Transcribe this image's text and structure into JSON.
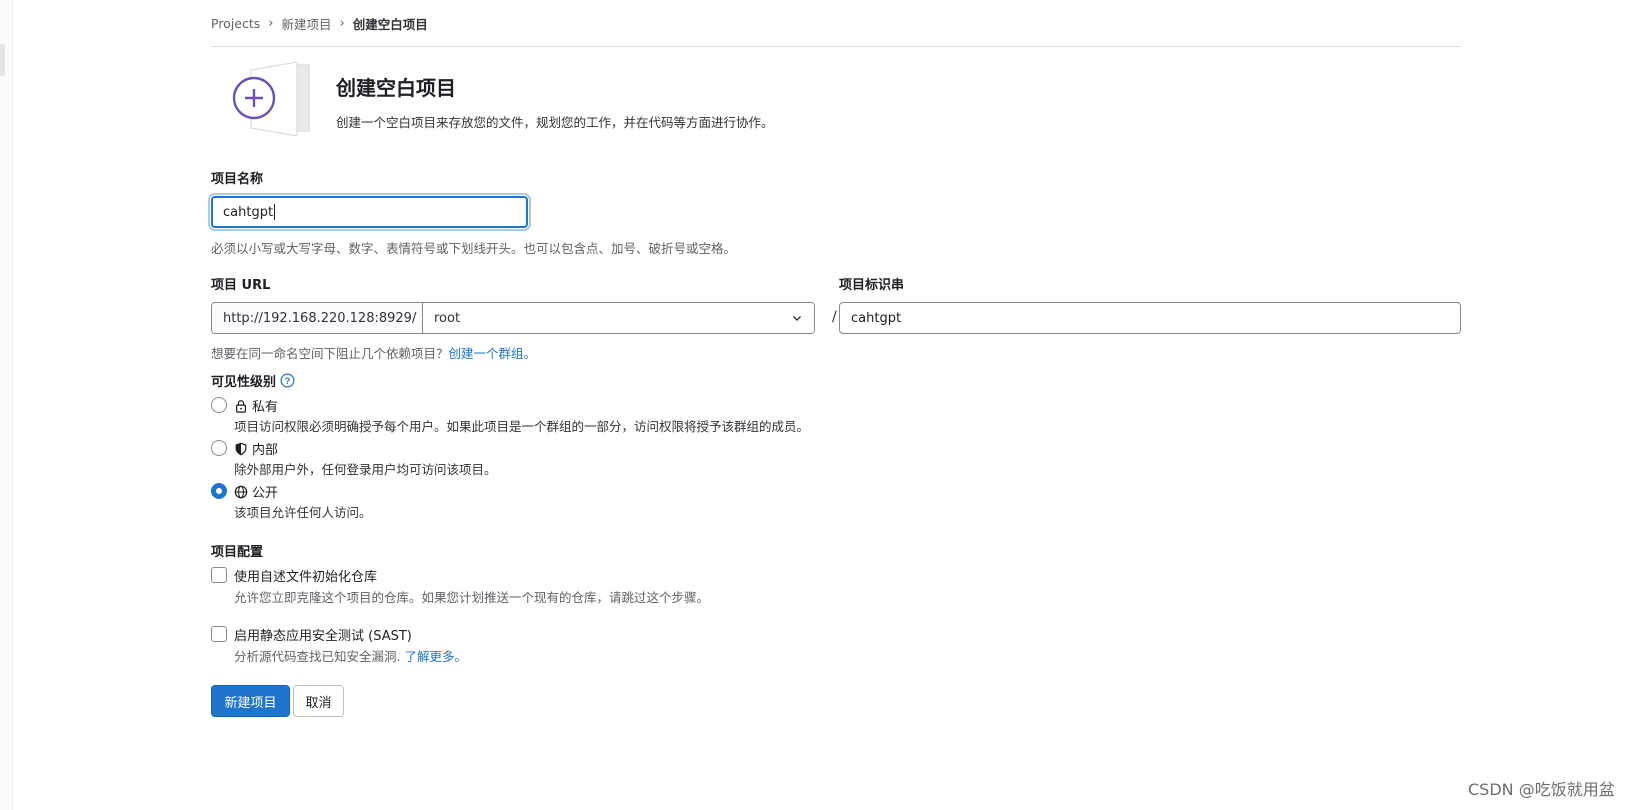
{
  "breadcrumb": {
    "items": [
      "Projects",
      "新建项目",
      "创建空白项目"
    ]
  },
  "header": {
    "title": "创建空白项目",
    "description": "创建一个空白项目来存放您的文件，规划您的工作，并在代码等方面进行协作。"
  },
  "project_name": {
    "label": "项目名称",
    "value": "cahtgpt",
    "hint": "必须以小写或大写字母、数字、表情符号或下划线开头。也可以包含点、加号、破折号或空格。"
  },
  "project_url": {
    "label": "项目 URL",
    "prefix": "http://192.168.220.128:8929/",
    "namespace": "root",
    "separator": "/",
    "hint": "想要在同一命名空间下阻止几个依赖项目？",
    "hint_link": "创建一个群组。"
  },
  "project_slug": {
    "label": "项目标识串",
    "value": "cahtgpt"
  },
  "visibility": {
    "label": "可见性级别",
    "options": [
      {
        "label": "私有",
        "icon": "lock-icon",
        "description": "项目访问权限必须明确授予每个用户。如果此项目是一个群组的一部分，访问权限将授予该群组的成员。",
        "checked": false
      },
      {
        "label": "内部",
        "icon": "shield-icon",
        "description": "除外部用户外，任何登录用户均可访问该项目。",
        "checked": false
      },
      {
        "label": "公开",
        "icon": "globe-icon",
        "description": "该项目允许任何人访问。",
        "checked": true
      }
    ]
  },
  "config": {
    "label": "项目配置",
    "readme": {
      "label": "使用自述文件初始化仓库",
      "description": "允许您立即克隆这个项目的仓库。如果您计划推送一个现有的仓库，请跳过这个步骤。",
      "checked": false
    },
    "sast": {
      "label": "启用静态应用安全测试 (SAST)",
      "description": "分析源代码查找已知安全漏洞.",
      "link": "了解更多。",
      "checked": false
    }
  },
  "actions": {
    "create": "新建项目",
    "cancel": "取消"
  },
  "colors": {
    "primary": "#1f75cb",
    "illustration_purple": "#6b4fbb"
  },
  "watermark": "CSDN @吃饭就用盆"
}
